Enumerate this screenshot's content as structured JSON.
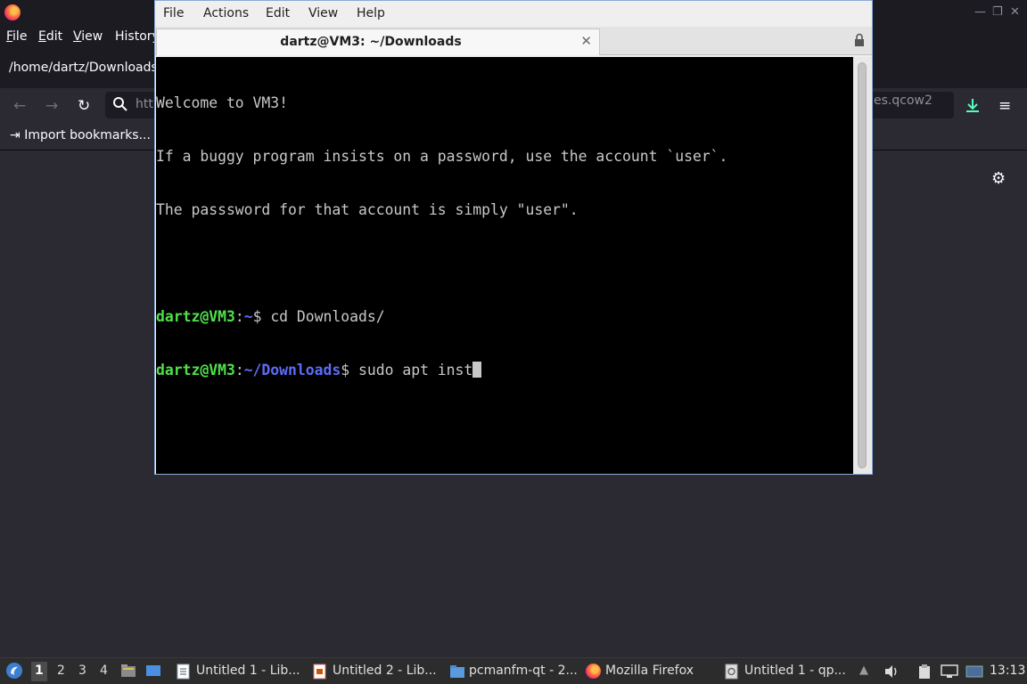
{
  "firefox": {
    "menus": [
      {
        "id": "file",
        "label": "File",
        "mnemonic": "F",
        "rest": "ile"
      },
      {
        "id": "edit",
        "label": "Edit",
        "mnemonic": "E",
        "rest": "dit"
      },
      {
        "id": "view",
        "label": "View",
        "mnemonic": "V",
        "rest": "iew"
      },
      {
        "id": "history",
        "label": "History",
        "mnemonic": "",
        "rest": "History"
      }
    ],
    "path_text": "/home/dartz/Downloads/",
    "url_visible": "htt",
    "download_partial": "es.qcow2",
    "bookmark_label": "Import bookmarks...",
    "icons": {
      "back": "back-arrow-icon",
      "forward": "forward-arrow-icon",
      "reload": "reload-icon",
      "search": "search-icon",
      "download": "download-icon",
      "menu": "hamburger-menu-icon",
      "settings": "gear-icon"
    }
  },
  "terminal": {
    "menus": [
      "File",
      "Actions",
      "Edit",
      "View",
      "Help"
    ],
    "tab_title": "dartz@VM3: ~/Downloads",
    "output_lines": [
      "Welcome to VM3!",
      "If a buggy program insists on a password, use the account `user`.",
      "The passsword for that account is simply \"user\"."
    ],
    "prompt_lines": [
      {
        "user_host": "dartz@VM3",
        "sep": ":",
        "path": "~",
        "symbol": "$ ",
        "command": "cd Downloads/"
      },
      {
        "user_host": "dartz@VM3",
        "sep": ":",
        "path": "~/Downloads",
        "symbol": "$ ",
        "command": "sudo apt inst"
      }
    ],
    "colors": {
      "prompt_user": "#4fe04b",
      "prompt_path": "#5c6cf7",
      "text": "#c8c8c8",
      "background": "#000000"
    }
  },
  "taskbar": {
    "workspaces": [
      "1",
      "2",
      "3",
      "4"
    ],
    "active_workspace": "1",
    "tasks": [
      {
        "label": "Untitled 1 - Lib...",
        "icon": "writer-document-icon"
      },
      {
        "label": "Untitled 2 - Lib...",
        "icon": "impress-document-icon"
      },
      {
        "label": "pcmanfm-qt - 2...",
        "icon": "folder-icon"
      },
      {
        "label": "Mozilla Firefox",
        "icon": "firefox-icon"
      },
      {
        "label": "Untitled 1 - qp...",
        "icon": "qpdfview-icon"
      }
    ],
    "clock": "13:13"
  }
}
